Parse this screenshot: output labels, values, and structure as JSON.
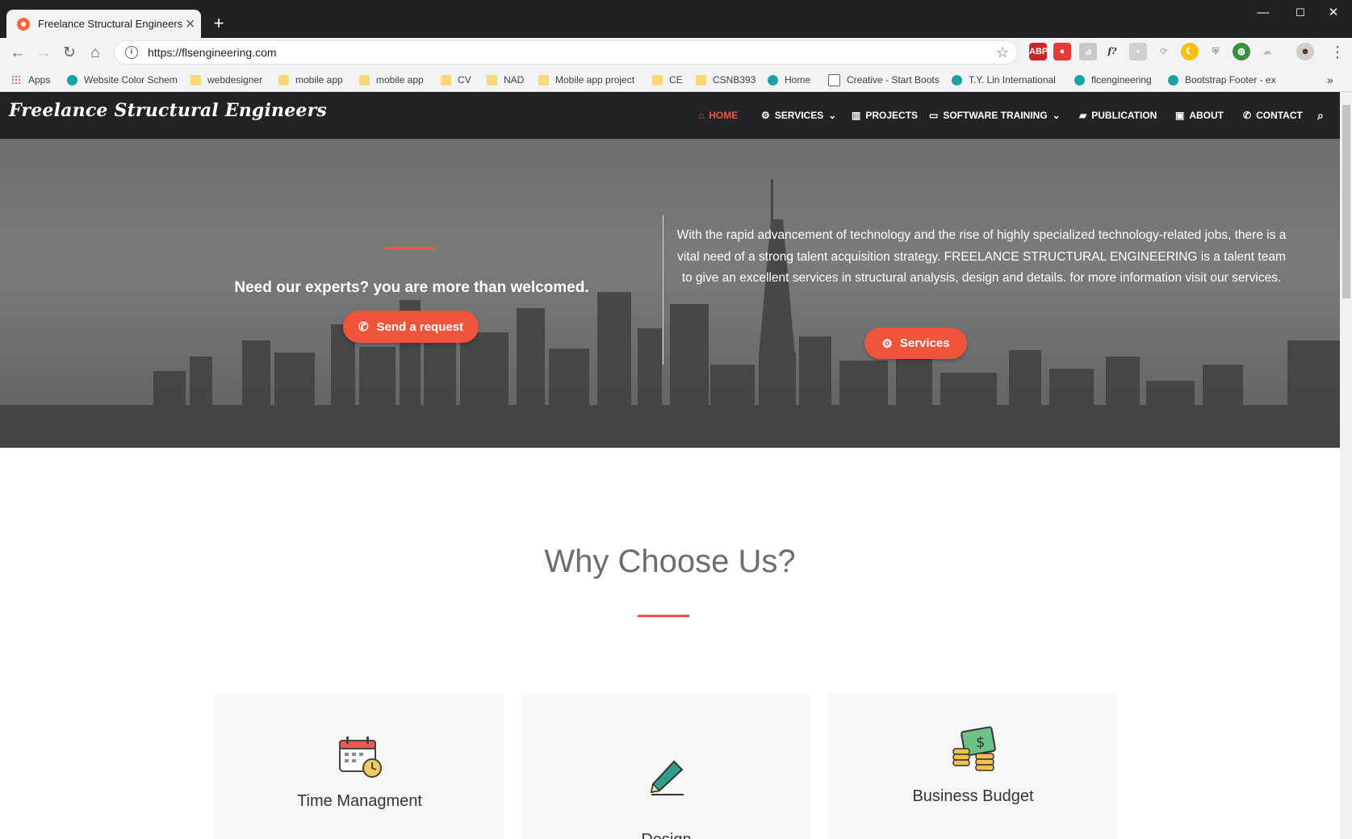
{
  "browser": {
    "tab_title": "Freelance Structural Engineers",
    "tab_close": "✕",
    "new_tab": "+",
    "url": "https://flsengineering.com",
    "window_controls": [
      "—",
      "☐",
      "✕"
    ]
  },
  "bookmarks": [
    {
      "label": "Apps",
      "icon": "apps-grid"
    },
    {
      "label": "Website Color Schem",
      "icon": "site"
    },
    {
      "label": "webdesigner",
      "icon": "folder"
    },
    {
      "label": "mobile app",
      "icon": "folder"
    },
    {
      "label": "mobile app",
      "icon": "folder"
    },
    {
      "label": "CV",
      "icon": "folder"
    },
    {
      "label": "NAD",
      "icon": "folder"
    },
    {
      "label": "Mobile app project",
      "icon": "folder"
    },
    {
      "label": "CE",
      "icon": "folder"
    },
    {
      "label": "CSNB393",
      "icon": "folder"
    },
    {
      "label": "Home",
      "icon": "site"
    },
    {
      "label": "Creative - Start Boots",
      "icon": "page"
    },
    {
      "label": "T.Y. Lin International",
      "icon": "site"
    },
    {
      "label": "flcengineering",
      "icon": "site"
    },
    {
      "label": "Bootstrap Footer - ex",
      "icon": "site"
    }
  ],
  "site": {
    "logo": "Freelance Structural Engineers",
    "menu": [
      {
        "label": "HOME",
        "icon": "home-icon",
        "active": true
      },
      {
        "label": "SERVICES",
        "icon": "gear-icon",
        "dropdown": true
      },
      {
        "label": "PROJECTS",
        "icon": "building-icon"
      },
      {
        "label": "SOFTWARE TRAINING",
        "icon": "monitor-icon",
        "dropdown": true
      },
      {
        "label": "PUBLICATION",
        "icon": "book-icon"
      },
      {
        "label": "ABOUT",
        "icon": "contact-card-icon"
      },
      {
        "label": "CONTACT",
        "icon": "phone-icon"
      }
    ]
  },
  "hero": {
    "left_heading": "Need our experts? you are more than welcomed.",
    "request_button": "Send a request",
    "description": "With the rapid advancement of technology and the rise of highly specialized technology-related jobs, there is a vital need of a strong talent acquisition strategy. FREELANCE STRUCTURAL ENGINEERING is a talent team to give an excellent services in structural analysis, design and details. for more information visit our services.",
    "services_button": "Services"
  },
  "why": {
    "title": "Why Choose Us?",
    "cards": [
      {
        "title": "Time Managment",
        "icon": "calendar-clock-icon"
      },
      {
        "title": "Design",
        "icon": "pencil-icon"
      },
      {
        "title": "Business Budget",
        "icon": "money-coins-icon"
      }
    ]
  },
  "colors": {
    "accent": "#f0553b",
    "nav_bg": "#222326"
  }
}
